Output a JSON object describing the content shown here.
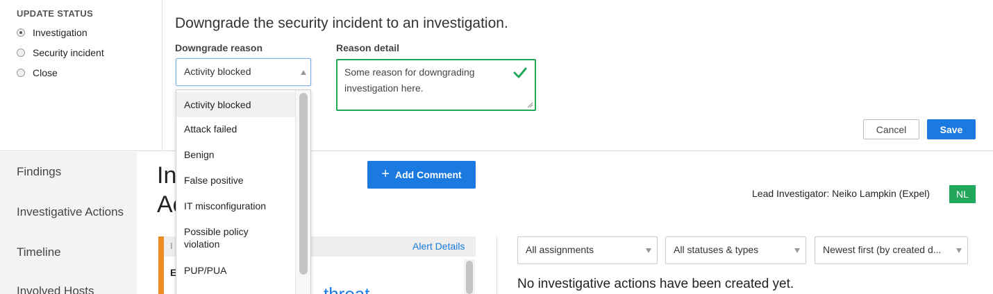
{
  "update_status": {
    "heading": "UPDATE STATUS",
    "options": [
      {
        "label": "Investigation",
        "checked": true
      },
      {
        "label": "Security incident",
        "checked": false
      },
      {
        "label": "Close",
        "checked": false
      }
    ]
  },
  "form": {
    "headline": "Downgrade the security incident to an investigation.",
    "reason_label": "Downgrade reason",
    "reason_selected": "Activity blocked",
    "detail_label": "Reason detail",
    "detail_value_line1": "Some reason for downgrading",
    "detail_value_line2": "investigation here.",
    "cancel_label": "Cancel",
    "save_label": "Save"
  },
  "dropdown": {
    "options": [
      "Activity blocked",
      "Attack failed",
      "Benign",
      "False positive",
      "IT misconfiguration",
      "Possible policy",
      "violation",
      "PUP/PUA"
    ]
  },
  "sidebar": {
    "items": [
      "Findings",
      "Investigative Actions",
      "Timeline",
      "Involved Hosts"
    ]
  },
  "main": {
    "title_line1": "In",
    "title_line2": "Ac",
    "add_comment_label": "Add Comment",
    "lead_investigator": "Lead Investigator: Neiko Lampkin (Expel)",
    "avatar_initials": "NL",
    "alert_header": "I",
    "alert_details_label": "Alert Details",
    "alert_bold": "E",
    "alert_threat": "threat",
    "filters": [
      "All assignments",
      "All statuses & types",
      "Newest first (by created d..."
    ],
    "empty_message": "No investigative actions have been created yet."
  },
  "colors": {
    "accent": "#1a7ae0",
    "success": "#22a85a",
    "alert_stripe": "#f08a24"
  }
}
